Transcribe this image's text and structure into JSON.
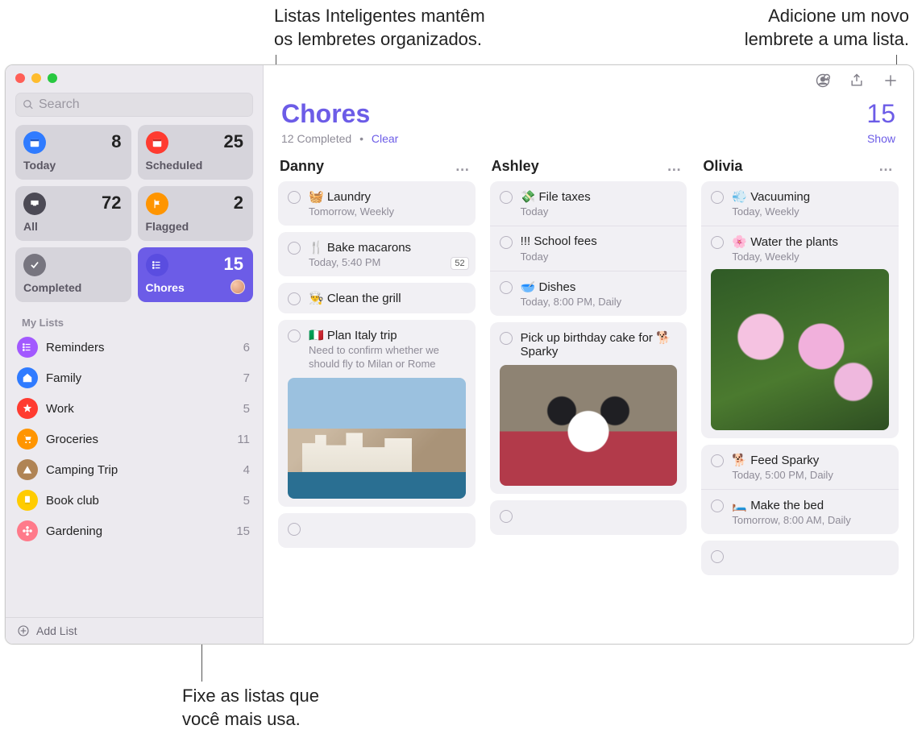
{
  "callouts": {
    "smart": "Listas Inteligentes mantêm\nos lembretes organizados.",
    "add": "Adicione um novo\nlembrete a uma lista.",
    "pin": "Fixe as listas que\nvocê mais usa."
  },
  "search": {
    "placeholder": "Search"
  },
  "smartTiles": {
    "today": {
      "label": "Today",
      "count": "8"
    },
    "scheduled": {
      "label": "Scheduled",
      "count": "25"
    },
    "all": {
      "label": "All",
      "count": "72"
    },
    "flagged": {
      "label": "Flagged",
      "count": "2"
    },
    "completed": {
      "label": "Completed",
      "count": ""
    },
    "chores": {
      "label": "Chores",
      "count": "15"
    }
  },
  "myListsHeader": "My Lists",
  "myLists": [
    {
      "name": "Reminders",
      "count": "6",
      "color": "#a259ff",
      "icon": "list"
    },
    {
      "name": "Family",
      "count": "7",
      "color": "#2f7bff",
      "icon": "home"
    },
    {
      "name": "Work",
      "count": "5",
      "color": "#ff3b30",
      "icon": "star"
    },
    {
      "name": "Groceries",
      "count": "11",
      "color": "#ff9500",
      "icon": "cart"
    },
    {
      "name": "Camping Trip",
      "count": "4",
      "color": "#b08455",
      "icon": "tent"
    },
    {
      "name": "Book club",
      "count": "5",
      "color": "#ffcc00",
      "icon": "book"
    },
    {
      "name": "Gardening",
      "count": "15",
      "color": "#ff7a8a",
      "icon": "flower"
    }
  ],
  "addList": "Add List",
  "header": {
    "title": "Chores",
    "count": "15",
    "completed": "12 Completed",
    "clear": "Clear",
    "show": "Show",
    "dot": "•"
  },
  "columns": [
    {
      "name": "Danny",
      "items": [
        {
          "emoji": "🧺",
          "title": "Laundry",
          "meta": "Tomorrow, Weekly"
        },
        {
          "emoji": "🍴",
          "title": "Bake macarons",
          "meta": "Today, 5:40 PM",
          "badge": "52"
        },
        {
          "emoji": "👨‍🍳",
          "title": "Clean the grill"
        },
        {
          "emoji": "🇮🇹",
          "title": "Plan Italy trip",
          "note": "Need to confirm whether we should fly to Milan or Rome",
          "image": "italy"
        }
      ]
    },
    {
      "name": "Ashley",
      "items": [
        {
          "emoji": "💸",
          "title": "File taxes",
          "meta": "Today",
          "group": 1
        },
        {
          "emoji": "",
          "title": "!!! School fees",
          "meta": "Today",
          "group": 1
        },
        {
          "emoji": "🥣",
          "title": "Dishes",
          "meta": "Today, 8:00 PM, Daily",
          "group": 1
        },
        {
          "emoji": "",
          "title": "Pick up birthday cake for 🐕 Sparky",
          "image": "dog"
        }
      ]
    },
    {
      "name": "Olivia",
      "items": [
        {
          "emoji": "💨",
          "title": "Vacuuming",
          "meta": "Today, Weekly",
          "group": 1
        },
        {
          "emoji": "🌸",
          "title": "Water the plants",
          "meta": "Today, Weekly",
          "image": "flowers",
          "group": 1
        },
        {
          "emoji": "🐕",
          "title": "Feed Sparky",
          "meta": "Today, 5:00 PM, Daily",
          "group": 2
        },
        {
          "emoji": "🛏️",
          "title": "Make the bed",
          "meta": "Tomorrow, 8:00 AM, Daily",
          "group": 2
        }
      ]
    }
  ],
  "moreGlyph": "…"
}
